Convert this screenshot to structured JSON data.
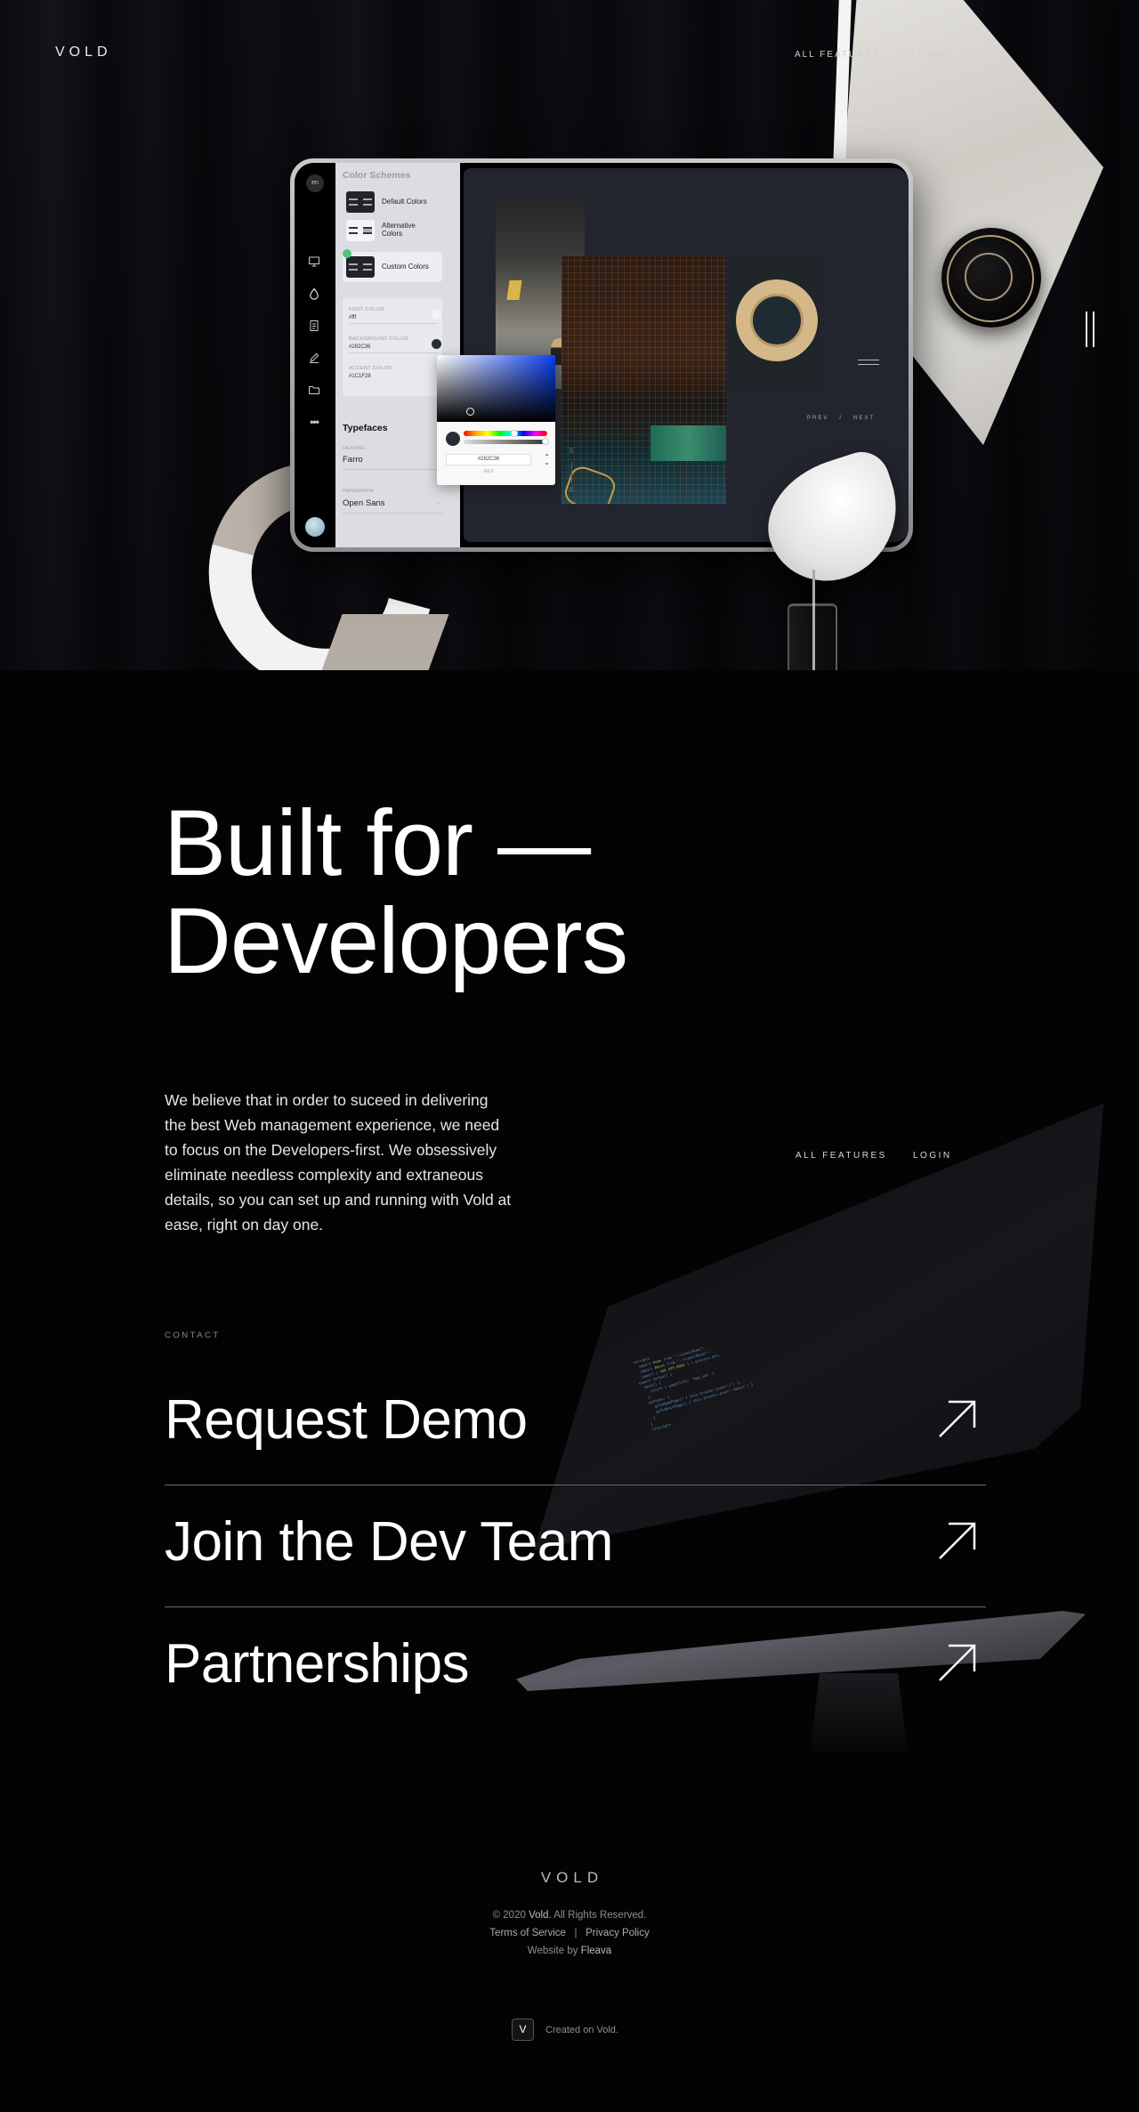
{
  "brand": {
    "logo": "VOLD"
  },
  "nav": {
    "items": [
      {
        "label": "ALL FEATURES"
      },
      {
        "label": "LOGIN"
      }
    ]
  },
  "hero_app": {
    "rail": {
      "language": "en",
      "icons": [
        "monitor-icon",
        "droplet-icon",
        "document-icon",
        "pencil-icon",
        "folder-icon",
        "more-icon"
      ]
    },
    "panel": {
      "title": "Color Schemes",
      "schemes": [
        {
          "label": "Default Colors",
          "selected": false
        },
        {
          "label": "Alternative Colors",
          "selected": false
        },
        {
          "label": "Custom Colors",
          "selected": true
        }
      ],
      "color_fields": [
        {
          "label": "FONT COLOR",
          "value": "#fff",
          "swatch": "#f2f2f2"
        },
        {
          "label": "BACKGROUND COLOR",
          "value": "#282C36",
          "swatch": "#282c36"
        },
        {
          "label": "ACCENT COLOR",
          "value": "#1C1F28"
        }
      ],
      "typefaces_title": "Typefaces",
      "heading_label": "HEADING",
      "heading_value": "Farro",
      "paragraph_label": "PARAGRAPH",
      "paragraph_value": "Open Sans"
    },
    "color_picker": {
      "hex_value": "#282C36",
      "mode_label": "HEX"
    },
    "gallery": {
      "slide_current": "01",
      "slide_total": "03",
      "prev_label": "PREV",
      "separator": "/",
      "next_label": "NEXT"
    }
  },
  "main": {
    "headline_line1": "Built for —",
    "headline_line2": "Developers",
    "intro": "We believe that in order to suceed in delivering the best Web management experience, we need to focus on the Developers-first. We obsessively eliminate needless complexity and extraneous details, so you can set up and running with Vold at ease, right on day one.",
    "nav_items": [
      {
        "label": "ALL FEATURES"
      },
      {
        "label": "LOGIN"
      }
    ],
    "contact_label": "CONTACT",
    "contact_links": [
      {
        "label": "Request Demo"
      },
      {
        "label": "Join the Dev Team"
      },
      {
        "label": "Partnerships"
      }
    ]
  },
  "footer": {
    "logo": "VOLD",
    "copyright_prefix": "© 2020 ",
    "copyright_brand": "Vold.",
    "copyright_suffix": " All Rights Reserved.",
    "terms": "Terms of Service",
    "divider": "|",
    "privacy": "Privacy Policy",
    "website_by_prefix": "Website by ",
    "website_by_name": "Fleava",
    "badge_letter": "V",
    "created_on": "Created on Vold."
  }
}
